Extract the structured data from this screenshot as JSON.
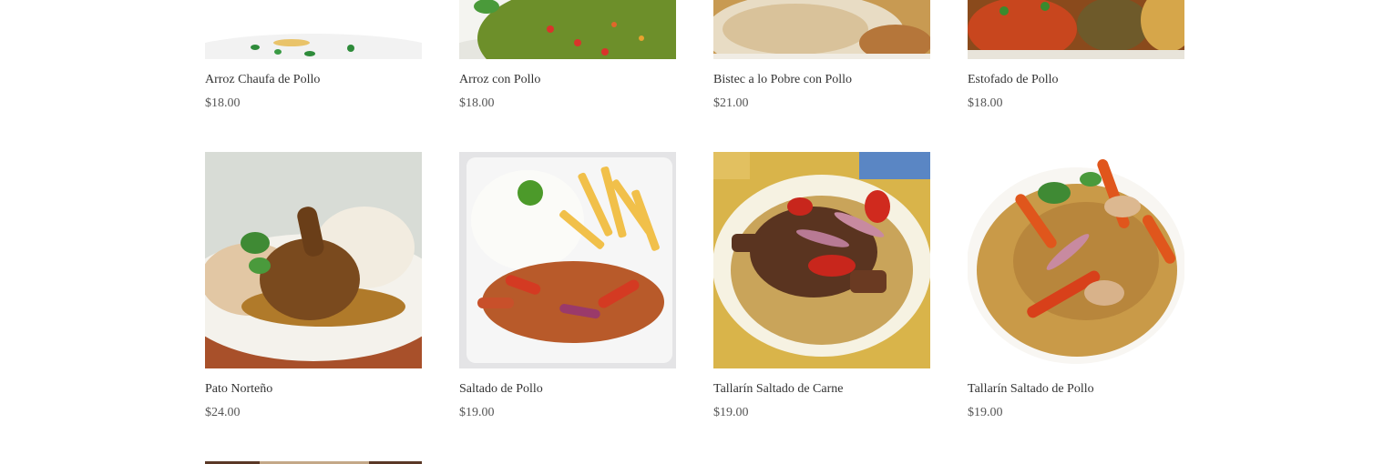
{
  "products": [
    {
      "name": "Arroz Chaufa de Pollo",
      "price": "$18.00",
      "image": "arroz-chaufa-photo"
    },
    {
      "name": "Arroz con Pollo",
      "price": "$18.00",
      "image": "arroz-con-pollo-photo"
    },
    {
      "name": "Bistec a lo Pobre con Pollo",
      "price": "$21.00",
      "image": "bistec-pobre-photo"
    },
    {
      "name": "Estofado de Pollo",
      "price": "$18.00",
      "image": "estofado-photo"
    },
    {
      "name": "Pato Norteño",
      "price": "$24.00",
      "image": "pato-norteno-photo"
    },
    {
      "name": "Saltado de Pollo",
      "price": "$19.00",
      "image": "saltado-pollo-photo"
    },
    {
      "name": "Tallarín Saltado de Carne",
      "price": "$19.00",
      "image": "tallarin-carne-photo"
    },
    {
      "name": "Tallarín Saltado de Pollo",
      "price": "$19.00",
      "image": "tallarin-pollo-photo"
    }
  ]
}
